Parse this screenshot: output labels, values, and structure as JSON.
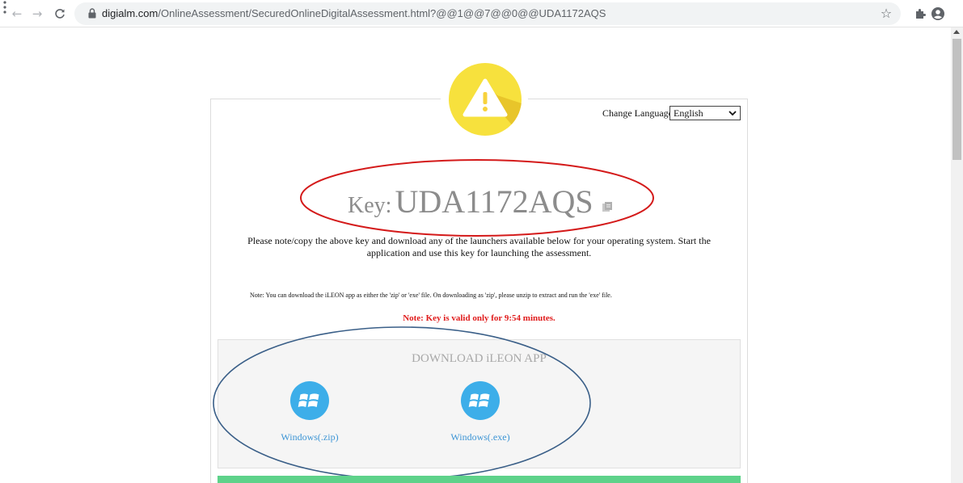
{
  "browser": {
    "url_host": "digialm.com",
    "url_path": "/OnlineAssessment/SecuredOnlineDigitalAssessment.html?@@1@@7@@0@@UDA1172AQS",
    "icons": [
      "back-arrow-icon",
      "forward-arrow-icon",
      "reload-icon",
      "lock-icon",
      "star-icon",
      "puzzle-extension-icon",
      "account-circle-icon",
      "kebab-menu-icon"
    ]
  },
  "page": {
    "warning_badge_color": "#f7e13d",
    "language": {
      "label": "Change Language",
      "selected": "English"
    },
    "key": {
      "label": "Key:",
      "value": "UDA1172AQS"
    },
    "instruction": "Please note/copy the above key and download any of the launchers available below for your operating system. Start the application and use this key for launching the assessment.",
    "download_note": "Note: You can download the iLEON app as either the 'zip' or 'exe' file. On downloading as 'zip', please unzip to extract and run the 'exe' file.",
    "validity_note": "Note: Key is valid only for 9:54 minutes.",
    "download": {
      "title": "DOWNLOAD iLEON APP",
      "items": [
        {
          "label": "Windows(.zip)",
          "icon": "windows-logo-icon"
        },
        {
          "label": "Windows(.exe)",
          "icon": "windows-logo-icon"
        }
      ]
    },
    "colors": {
      "accent_blue": "#3daee9",
      "link_blue": "#3d95d5",
      "warning_red": "#e01b1b",
      "highlight_green": "#5ed28a"
    }
  }
}
